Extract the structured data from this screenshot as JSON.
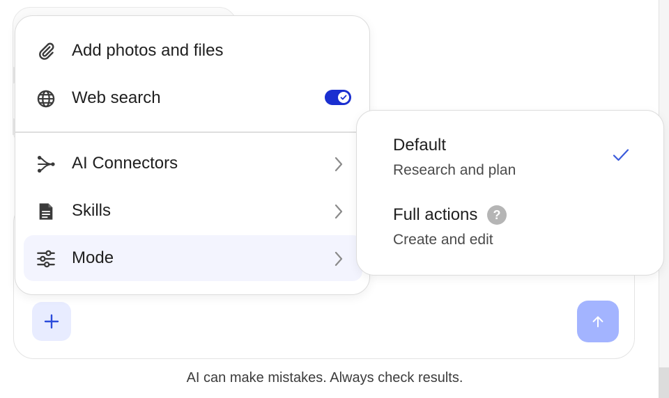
{
  "menu": {
    "items": [
      {
        "label": "Add photos and files",
        "icon": "paperclip-icon"
      },
      {
        "label": "Web search",
        "icon": "globe-icon",
        "toggle_on": true
      },
      {
        "label": "AI Connectors",
        "icon": "connectors-icon"
      },
      {
        "label": "Skills",
        "icon": "document-icon"
      },
      {
        "label": "Mode",
        "icon": "sliders-icon"
      }
    ]
  },
  "mode_submenu": {
    "options": [
      {
        "title": "Default",
        "description": "Research and plan",
        "selected": true
      },
      {
        "title": "Full actions",
        "description": "Create and edit",
        "selected": false,
        "help_glyph": "?"
      }
    ]
  },
  "composer": {
    "plus_icon": "plus-icon",
    "send_icon": "arrow-up-icon"
  },
  "disclaimer": "AI can make mistakes. Always check results.",
  "colors": {
    "toggle_on": "#1a2fd0",
    "accent": "#3b5bdb",
    "send_button": "#a3b4ff",
    "plus_button_bg": "#e8ecff",
    "active_row_bg": "#f3f4fe"
  }
}
